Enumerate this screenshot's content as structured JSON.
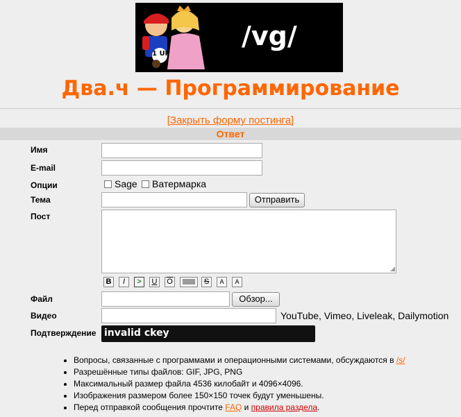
{
  "banner": {
    "text": "/vg/",
    "badge": "1 UP"
  },
  "title": "Два.ч — Программирование",
  "close_form_link": "[Закрыть форму постинга]",
  "reply_header": "Ответ",
  "form": {
    "name_label": "Имя",
    "email_label": "E-mail",
    "options_label": "Опции",
    "sage_label": "Sage",
    "watermark_label": "Ватермарка",
    "subject_label": "Тема",
    "submit_label": "Отправить",
    "post_label": "Пост",
    "file_label": "Файл",
    "browse_label": "Обзор...",
    "video_label": "Видео",
    "video_note": "YouTube, Vimeo, Liveleak, Dailymotion",
    "captcha_label": "Подтверждение",
    "captcha_text": "invalid ckey"
  },
  "markup_buttons": [
    "B",
    "I",
    ">",
    "U",
    "O",
    "",
    "S",
    "A",
    "A"
  ],
  "rules": {
    "item1_text": "Вопросы, связанные с программами и операционными системами, обсуждаются в ",
    "item1_link": "/s/",
    "item2": "Разрешённые типы файлов: GIF, JPG, PNG",
    "item3": "Максимальный размер файла 4536 килобайт и 4096×4096.",
    "item4": "Изображения размером более 150×150 точек будут уменьшены.",
    "item5_text": "Перед отправкой сообщения прочтите ",
    "item5_link1": "FAQ",
    "item5_mid": " и ",
    "item5_link2": "правила раздела",
    "item5_end": "."
  },
  "colors": {
    "accent": "#ff6600",
    "rules_link": "#cc0000",
    "background": "#eeeeee",
    "header_bar": "#d8d8d8"
  }
}
